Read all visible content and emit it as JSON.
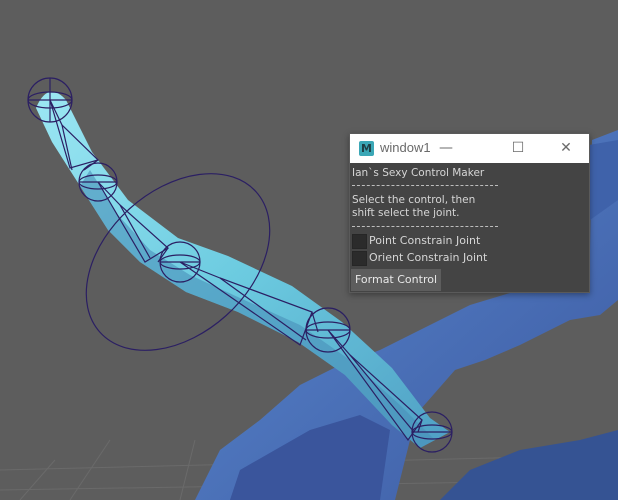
{
  "window": {
    "title": "window1",
    "app_icon_letter": "M",
    "controls": {
      "minimize": "—",
      "maximize": "☐",
      "close": "✕"
    }
  },
  "tool": {
    "heading": "Ian`s Sexy Control Maker",
    "instruction_line1": "Select the control, then",
    "instruction_line2": "shift select the joint.",
    "options": [
      {
        "label": "Point Constrain Joint",
        "checked": false
      },
      {
        "label": "Orient Constrain Joint",
        "checked": false
      }
    ],
    "button_label": "Format Control"
  },
  "colors": {
    "viewport_background": "#5d5d5d",
    "mesh_cyan": "#6ed3e6",
    "mesh_blue": "#4f73b8",
    "joint_wire": "#2b1f63",
    "panel_background": "#444444",
    "titlebar_background": "#ffffff",
    "app_icon": "#3ba7b6"
  }
}
